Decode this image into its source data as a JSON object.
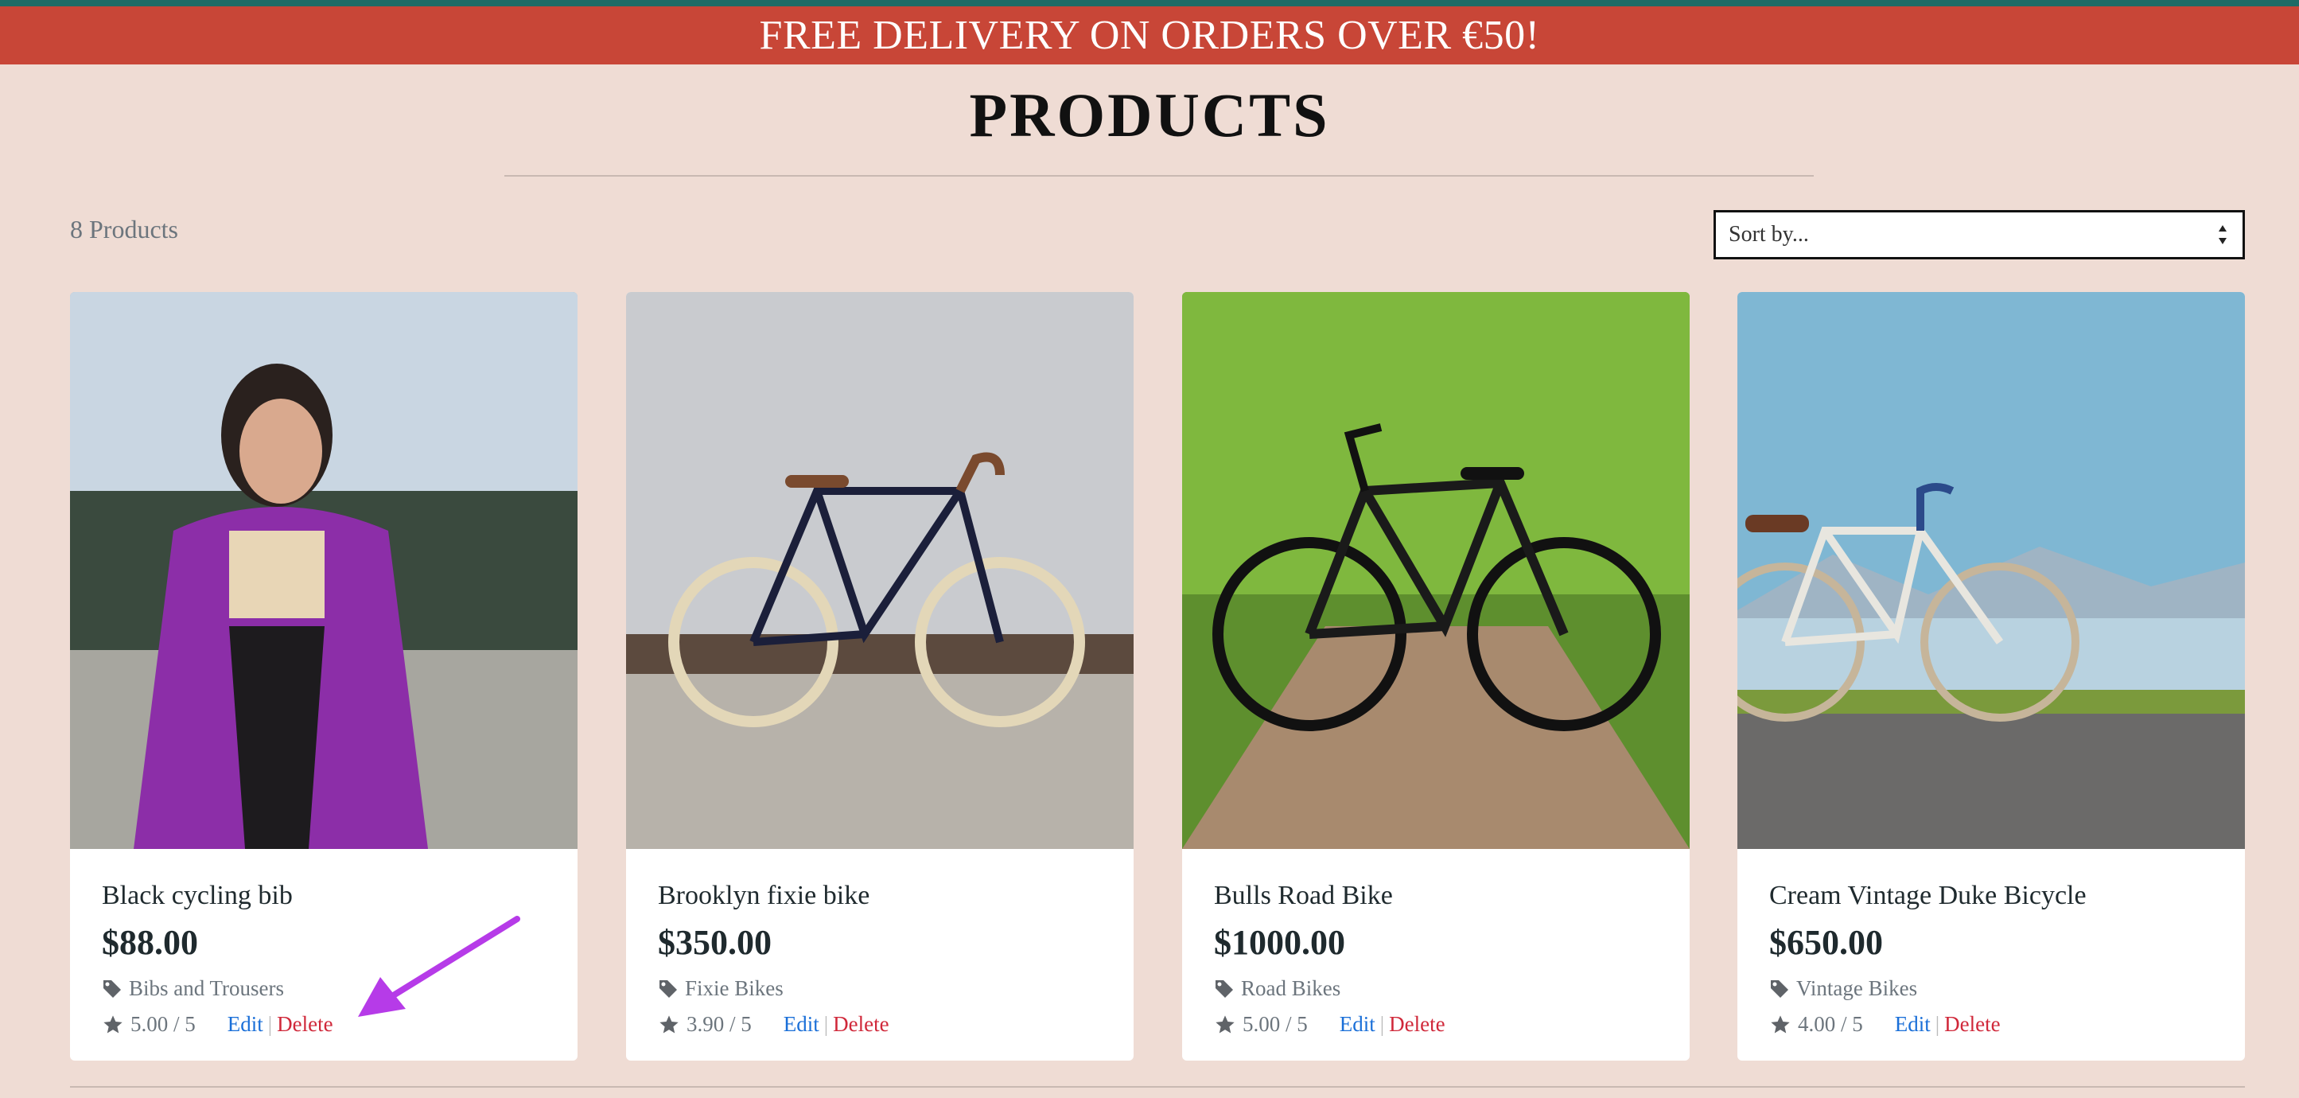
{
  "banner": {
    "text": "FREE DELIVERY ON ORDERS OVER €50!"
  },
  "page": {
    "title": "PRODUCTS"
  },
  "toolbar": {
    "product_count": "8 Products",
    "sort_placeholder": "Sort by..."
  },
  "products": [
    {
      "name": "Black cycling bib",
      "price": "$88.00",
      "category": "Bibs and Trousers",
      "rating": "5.00 / 5",
      "edit_label": "Edit",
      "delete_label": "Delete"
    },
    {
      "name": "Brooklyn fixie bike",
      "price": "$350.00",
      "category": "Fixie Bikes",
      "rating": "3.90 / 5",
      "edit_label": "Edit",
      "delete_label": "Delete"
    },
    {
      "name": "Bulls Road Bike",
      "price": "$1000.00",
      "category": "Road Bikes",
      "rating": "5.00 / 5",
      "edit_label": "Edit",
      "delete_label": "Delete"
    },
    {
      "name": "Cream Vintage Duke Bicycle",
      "price": "$650.00",
      "category": "Vintage Bikes",
      "rating": "4.00 / 5",
      "edit_label": "Edit",
      "delete_label": "Delete"
    }
  ],
  "colors": {
    "background": "#efdcd4",
    "banner": "#c84637",
    "top_strip": "#1e6b66",
    "edit_link": "#1a6fd8",
    "delete_link": "#d0283a",
    "annotation_arrow": "#b63be8"
  },
  "icons": [
    "tag-icon",
    "star-icon",
    "sort-arrows-icon",
    "annotation-arrow"
  ]
}
